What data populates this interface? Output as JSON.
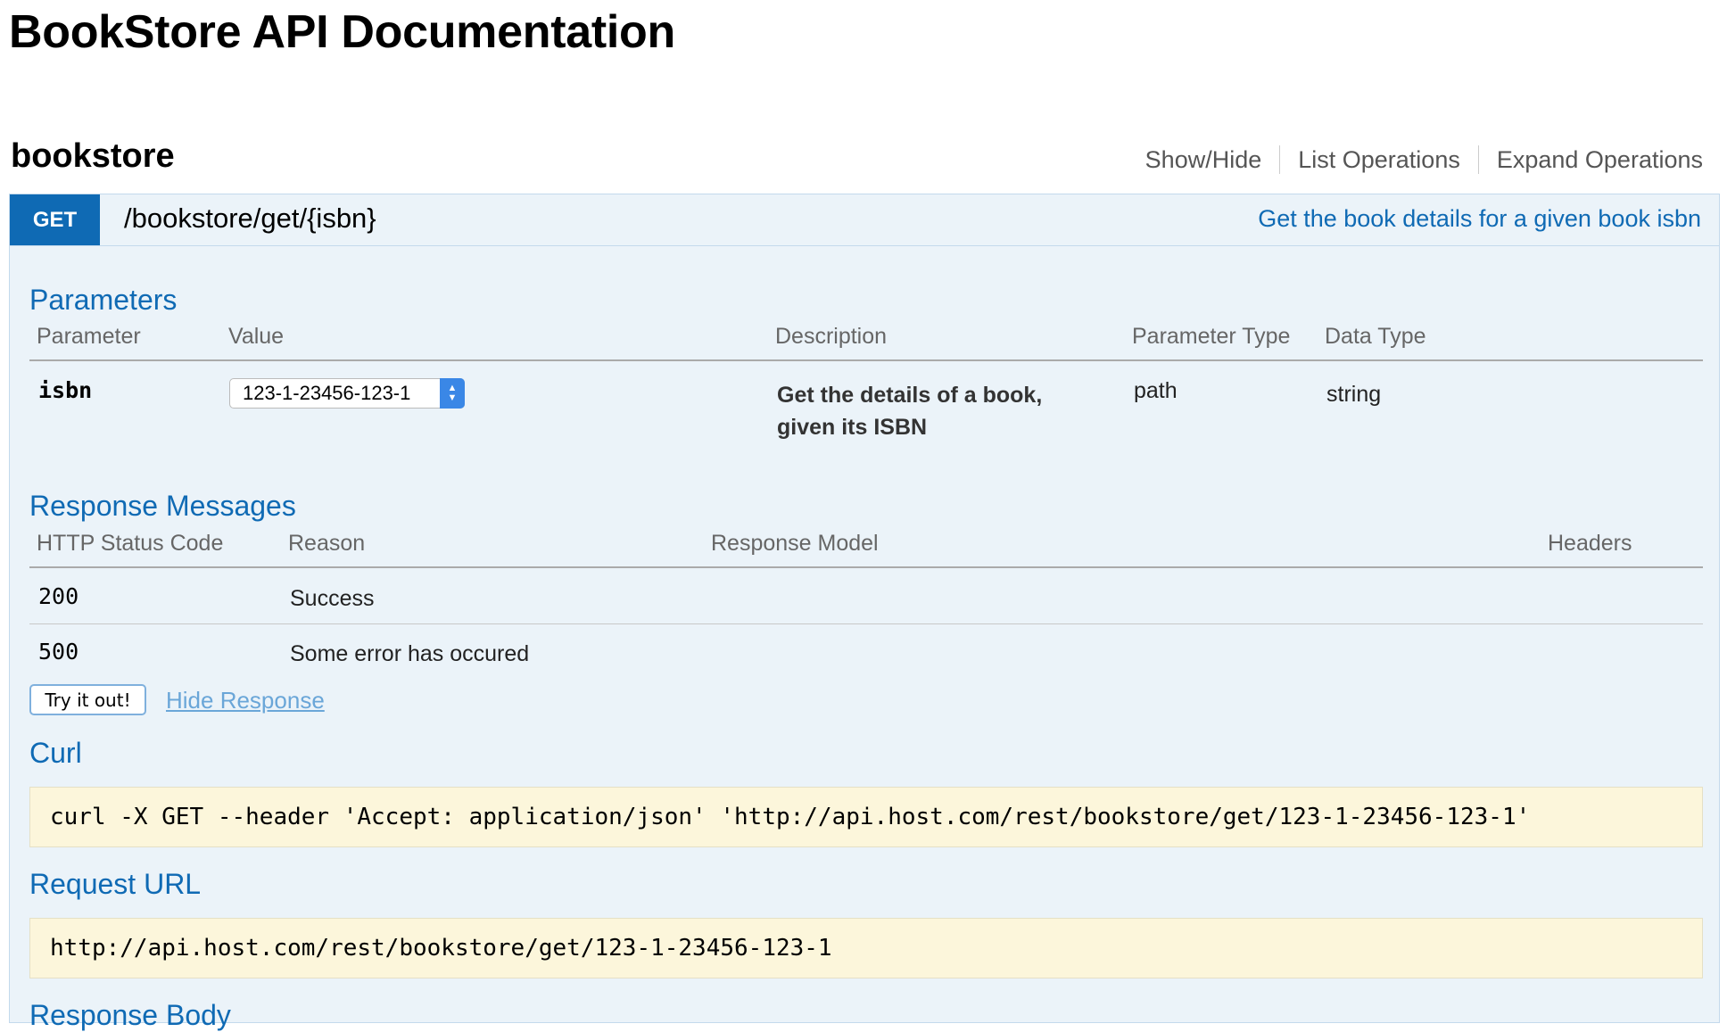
{
  "page": {
    "title": "BookStore API Documentation"
  },
  "resource": {
    "name": "bookstore",
    "options": [
      "Show/Hide",
      "List Operations",
      "Expand Operations"
    ]
  },
  "operation": {
    "method": "GET",
    "path": "/bookstore/get/{isbn}",
    "summary": "Get the book details for a given book isbn",
    "parameters": {
      "heading": "Parameters",
      "columns": [
        "Parameter",
        "Value",
        "Description",
        "Parameter Type",
        "Data Type"
      ],
      "rows": [
        {
          "name": "isbn",
          "value": "123-1-23456-123-1",
          "description_line1": "Get the details of a book,",
          "description_line2": "given its ISBN",
          "param_type": "path",
          "data_type": "string"
        }
      ]
    },
    "responses": {
      "heading": "Response Messages",
      "columns": [
        "HTTP Status Code",
        "Reason",
        "Response Model",
        "Headers"
      ],
      "rows": [
        {
          "code": "200",
          "reason": "Success"
        },
        {
          "code": "500",
          "reason": "Some error has occured"
        }
      ]
    },
    "try_button": "Try it out!",
    "hide_response": "Hide Response",
    "curl": {
      "heading": "Curl",
      "command": "curl -X GET --header 'Accept: application/json' 'http://api.host.com/rest/bookstore/get/123-1-23456-123-1'"
    },
    "request_url": {
      "heading": "Request URL",
      "value": "http://api.host.com/rest/bookstore/get/123-1-23456-123-1"
    },
    "response_body_heading": "Response Body"
  },
  "colors": {
    "accent": "#0f6ab4",
    "operation_bg": "#ebf3f9",
    "code_bg": "#fcf6db"
  }
}
